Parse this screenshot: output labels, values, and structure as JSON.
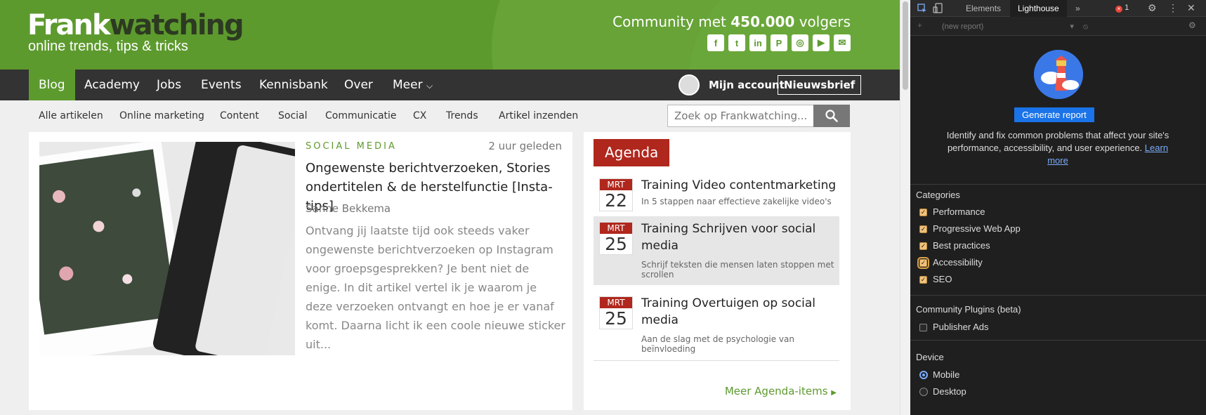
{
  "site": {
    "logo_main": "Frank",
    "logo_main2": "watching",
    "logo_sub": "online trends, tips & tricks",
    "community_prefix": "Community met ",
    "community_count": "450.000",
    "community_suffix": " volgers",
    "socials": [
      "facebook-icon",
      "twitter-icon",
      "linkedin-icon",
      "pinterest-icon",
      "instagram-icon",
      "youtube-icon",
      "email-icon"
    ],
    "social_glyphs": [
      "f",
      "t",
      "in",
      "P",
      "◎",
      "▶",
      "✉"
    ],
    "nav": [
      "Blog",
      "Academy",
      "Jobs",
      "Events",
      "Kennisbank",
      "Over",
      "Meer"
    ],
    "account": "Mijn account",
    "newsletter": "Nieuwsbrief",
    "subnav": [
      "Alle artikelen",
      "Online marketing",
      "Content",
      "Social",
      "Communicatie",
      "CX",
      "Trends",
      "Artikel inzenden"
    ],
    "search_placeholder": "Zoek op Frankwatching...",
    "colors": {
      "brand_green": "#5d9a2e",
      "agenda_red": "#b0271d",
      "nav_dark": "#333333"
    }
  },
  "article": {
    "category": "SOCIAL MEDIA",
    "time": "2 uur geleden",
    "title": "Ongewenste berichtverzoeken, Stories ondertitelen & de herstelfunctie [Insta-tips]",
    "author": "Sanne Bekkema",
    "excerpt": "Ontvang jij laatste tijd ook steeds vaker ongewenste berichtverzoeken op Instagram voor groepsgesprekken? Je bent niet de enige. In dit artikel vertel ik je waarom je deze verzoeken ontvangt en hoe je er vanaf komt. Daarna licht ik een coole nieuwe sticker uit..."
  },
  "agenda": {
    "heading": "Agenda",
    "items": [
      {
        "month": "MRT",
        "day": "22",
        "title": "Training Video contentmarketing",
        "subtitle": "In 5 stappen naar effectieve zakelijke video's"
      },
      {
        "month": "MRT",
        "day": "25",
        "title": "Training Schrijven voor social media",
        "subtitle": "Schrijf teksten die mensen laten stoppen met scrollen"
      },
      {
        "month": "MRT",
        "day": "25",
        "title": "Training Overtuigen op social media",
        "subtitle": "Aan de slag met de psychologie van beïnvloeding"
      }
    ],
    "more": "Meer Agenda-items"
  },
  "devtools": {
    "tabs": [
      "Elements",
      "Lighthouse"
    ],
    "more_tabs": "»",
    "error_count": "1",
    "new_report": "(new report)",
    "generate": "Generate report",
    "description": "Identify and fix common problems that affect your site's performance, accessibility, and user experience.",
    "learn_more": "Learn more",
    "categories_title": "Categories",
    "categories": [
      "Performance",
      "Progressive Web App",
      "Best practices",
      "Accessibility",
      "SEO"
    ],
    "plugins_title": "Community Plugins (beta)",
    "plugins": [
      "Publisher Ads"
    ],
    "device_title": "Device",
    "devices": [
      "Mobile",
      "Desktop"
    ],
    "selected_device": "Mobile"
  }
}
